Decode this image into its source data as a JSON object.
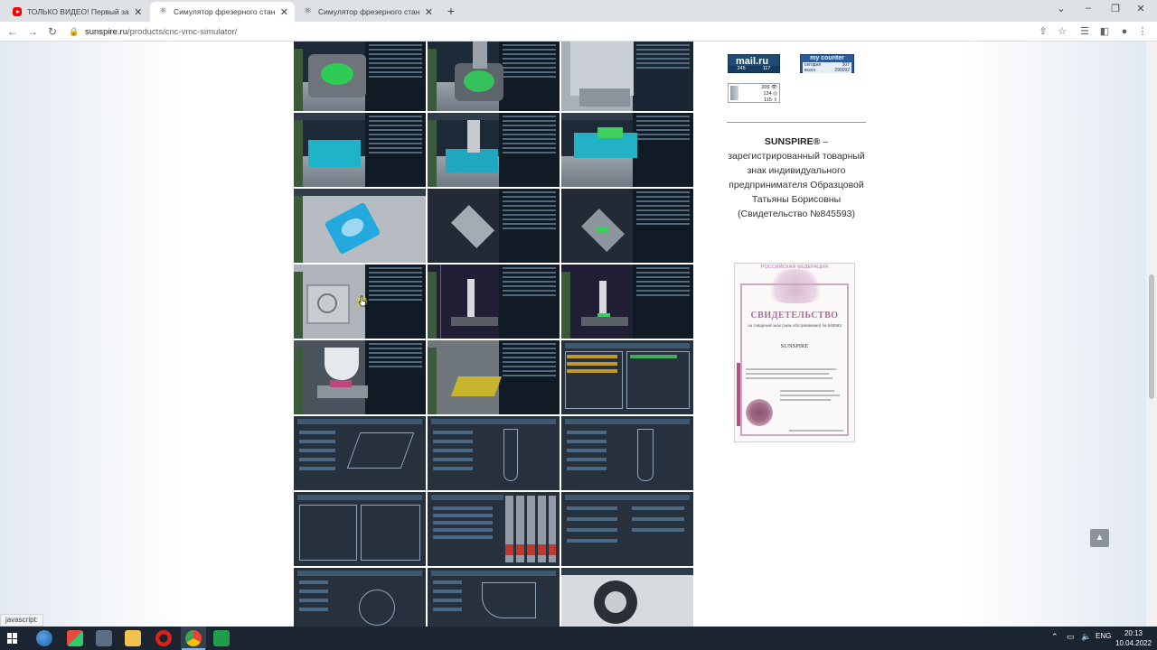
{
  "browser": {
    "tabs": [
      {
        "title": "ТОЛЬКО ВИДЕО! Первый запуск",
        "icon": "youtube-icon",
        "active": false
      },
      {
        "title": "Симулятор фрезерного станка",
        "icon": "atom-icon",
        "active": true
      },
      {
        "title": "Симулятор фрезерного станка",
        "icon": "atom-icon",
        "active": false
      }
    ],
    "new_tab_glyph": "+",
    "window_controls": {
      "tab_search": "⌄",
      "minimize": "–",
      "restore": "❐",
      "close": "✕"
    },
    "toolbar": {
      "back": "←",
      "forward": "→",
      "reload": "↻"
    },
    "address": {
      "domain": "sunspire.ru",
      "path": "/products/cnc-vmc-simulator/"
    },
    "toolbar_right": {
      "share": "⇪",
      "bookmark": "☆",
      "reading_list": "☰",
      "side_panel": "◧",
      "profile": "●",
      "menu": "⋮"
    },
    "status_text": "javascript:"
  },
  "page": {
    "counters": {
      "mailru": {
        "brand": "mail.ru",
        "left": "245",
        "right": "117"
      },
      "mycounter": {
        "brand": "my counter",
        "today_label": "сегодня",
        "today": "307",
        "total_label": "всего",
        "total": "290092"
      },
      "liveinternet": {
        "line1": "209 👁",
        "line2": "134 ◎",
        "line3": "115 ⇧"
      }
    },
    "trademark": {
      "brand": "SUNSPIRE®",
      "dash": " –",
      "text": "зарегистрированный товарный знак индивидуального предпринимателя Образцовой Татьяны Борисовны (Свидетельство №845593)"
    },
    "certificate": {
      "header": "РОССИЙСКАЯ ФЕДЕРАЦИЯ",
      "title": "СВИДЕТЕЛЬСТВО",
      "subtitle": "на товарный знак (знак обслуживания) № 845593",
      "mark": "SUNSPIRE"
    },
    "scroll_top_glyph": "▲"
  },
  "taskbar": {
    "tray": {
      "chevron": "⌃",
      "lang": "ENG"
    },
    "clock": {
      "time": "20:13",
      "date": "10.04.2022"
    }
  }
}
